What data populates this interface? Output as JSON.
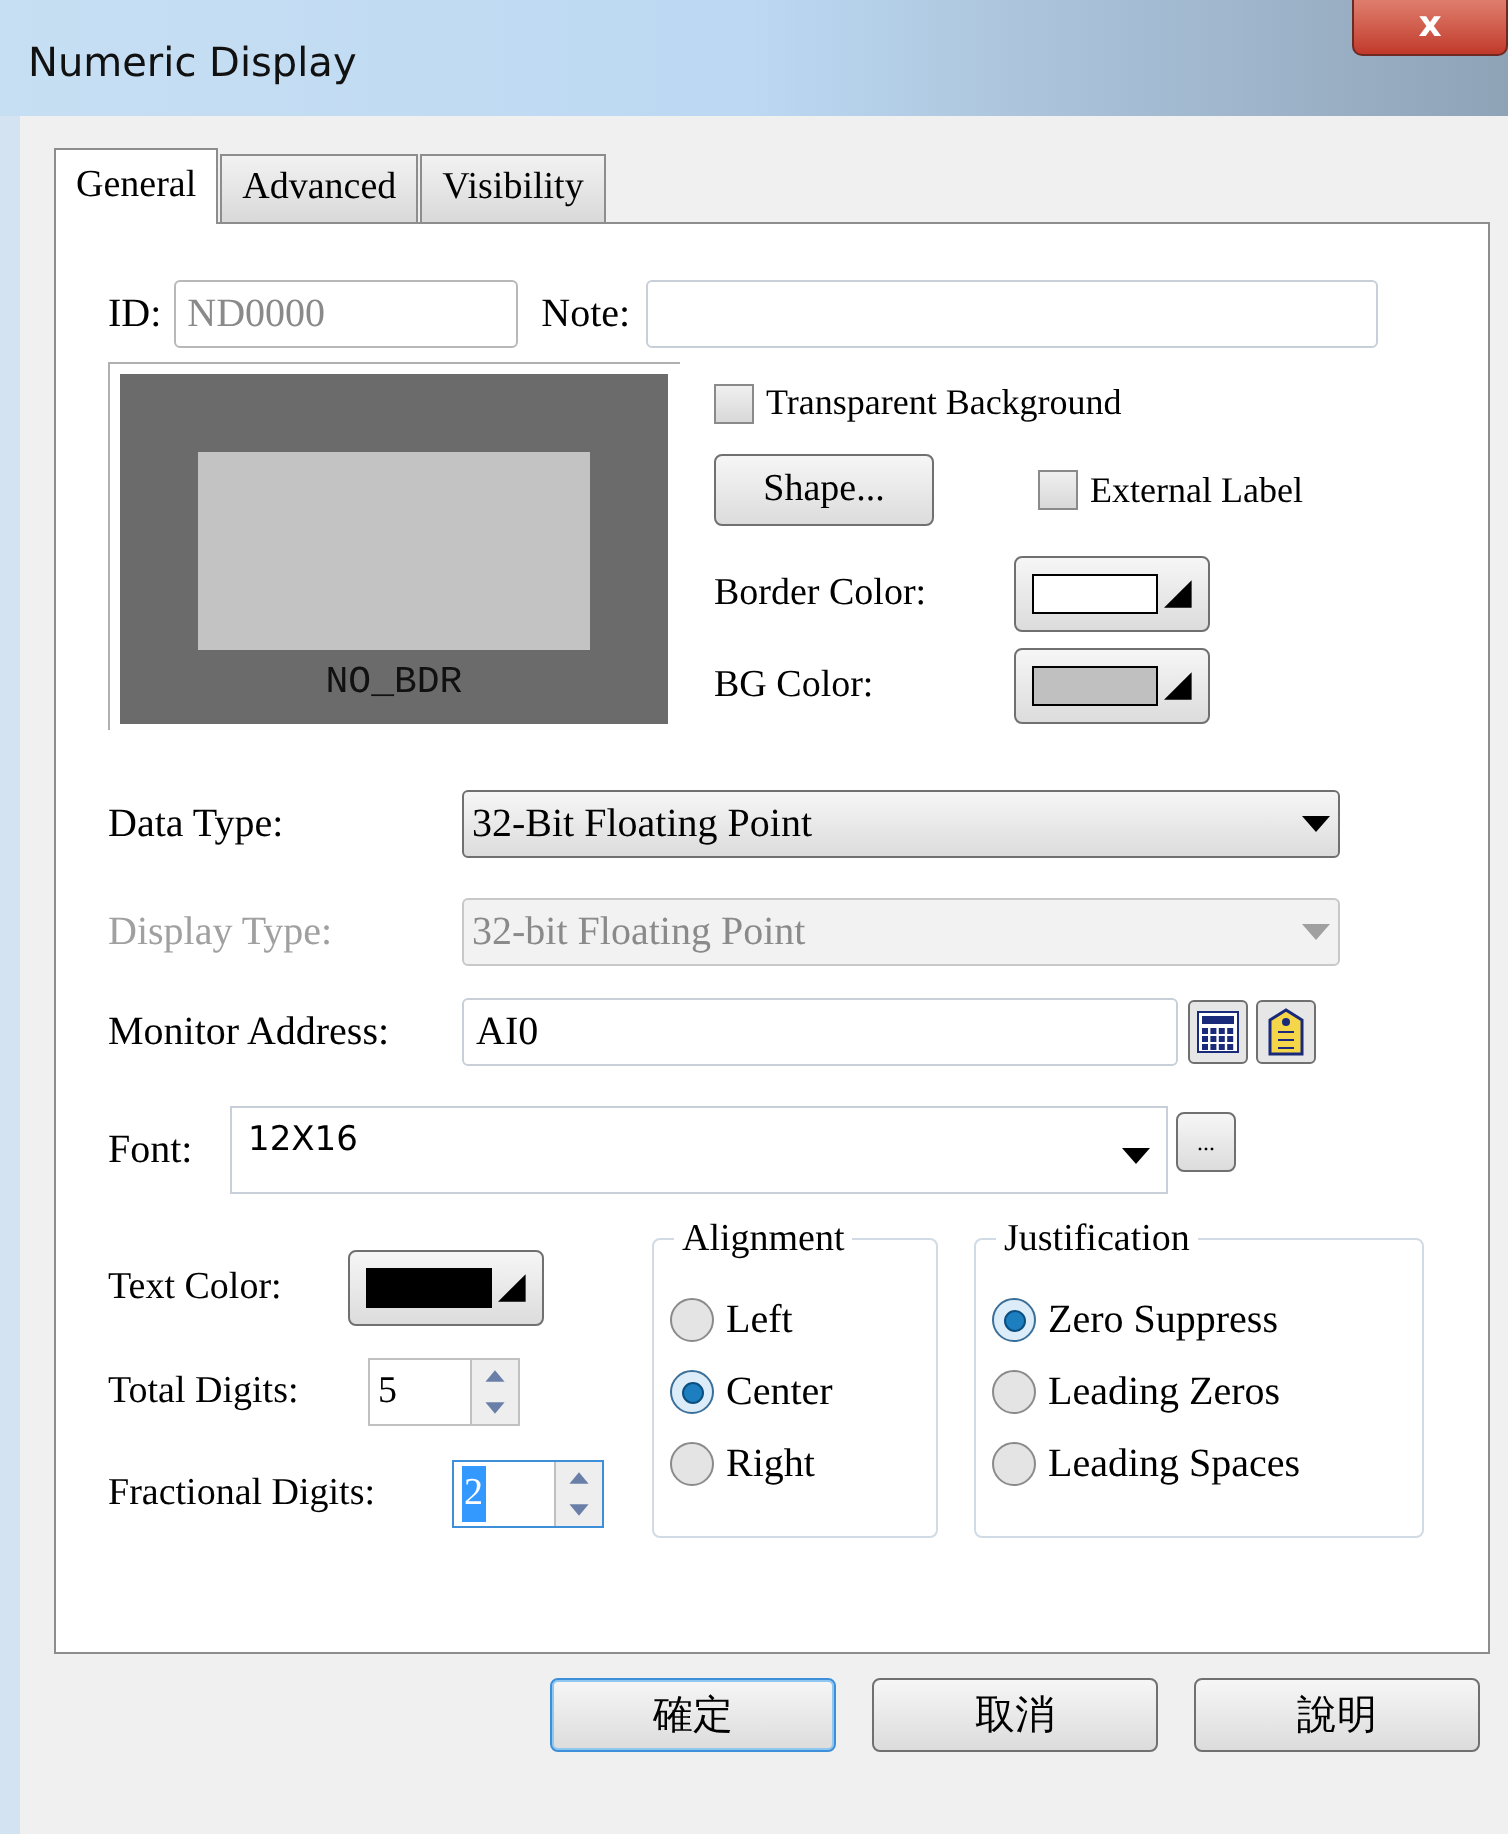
{
  "window": {
    "title": "Numeric Display",
    "close": "x"
  },
  "tabs": [
    {
      "label": "General",
      "selected": true
    },
    {
      "label": "Advanced",
      "selected": false
    },
    {
      "label": "Visibility",
      "selected": false
    }
  ],
  "id_field": {
    "label": "ID:",
    "value": "ND0000",
    "disabled": true
  },
  "note_field": {
    "label": "Note:"
  },
  "preview": {
    "caption": "NO_BDR"
  },
  "transparent_background": {
    "label": "Transparent Background",
    "checked": false
  },
  "shape_button": "Shape...",
  "external_label": {
    "label": "External Label",
    "checked": false
  },
  "border_color": {
    "label": "Border Color:",
    "color": "#ffffff"
  },
  "bg_color": {
    "label": "BG Color:",
    "color": "#c0c0c0"
  },
  "data_type": {
    "label": "Data Type:",
    "value": "32-Bit Floating Point",
    "disabled": false
  },
  "display_type": {
    "label": "Display Type:",
    "value": "32-bit Floating Point",
    "disabled": true
  },
  "monitor_address": {
    "label": "Monitor Address:",
    "value": "AI0"
  },
  "font": {
    "label": "Font:",
    "value": "12X16",
    "more": "..."
  },
  "text_color": {
    "label": "Text Color:",
    "color": "#000000"
  },
  "total_digits": {
    "label": "Total Digits:",
    "value": "5",
    "focused": false
  },
  "fractional_digits": {
    "label": "Fractional Digits:",
    "value": "2",
    "focused": true
  },
  "alignment": {
    "title": "Alignment",
    "options": [
      {
        "label": "Left",
        "selected": false
      },
      {
        "label": "Center",
        "selected": true
      },
      {
        "label": "Right",
        "selected": false
      }
    ]
  },
  "justification": {
    "title": "Justification",
    "options": [
      {
        "label": "Zero Suppress",
        "selected": true
      },
      {
        "label": "Leading Zeros",
        "selected": false
      },
      {
        "label": "Leading Spaces",
        "selected": false
      }
    ]
  },
  "buttons": [
    {
      "label": "確定",
      "default": true
    },
    {
      "label": "取消",
      "default": false
    },
    {
      "label": "說明",
      "default": false
    }
  ]
}
